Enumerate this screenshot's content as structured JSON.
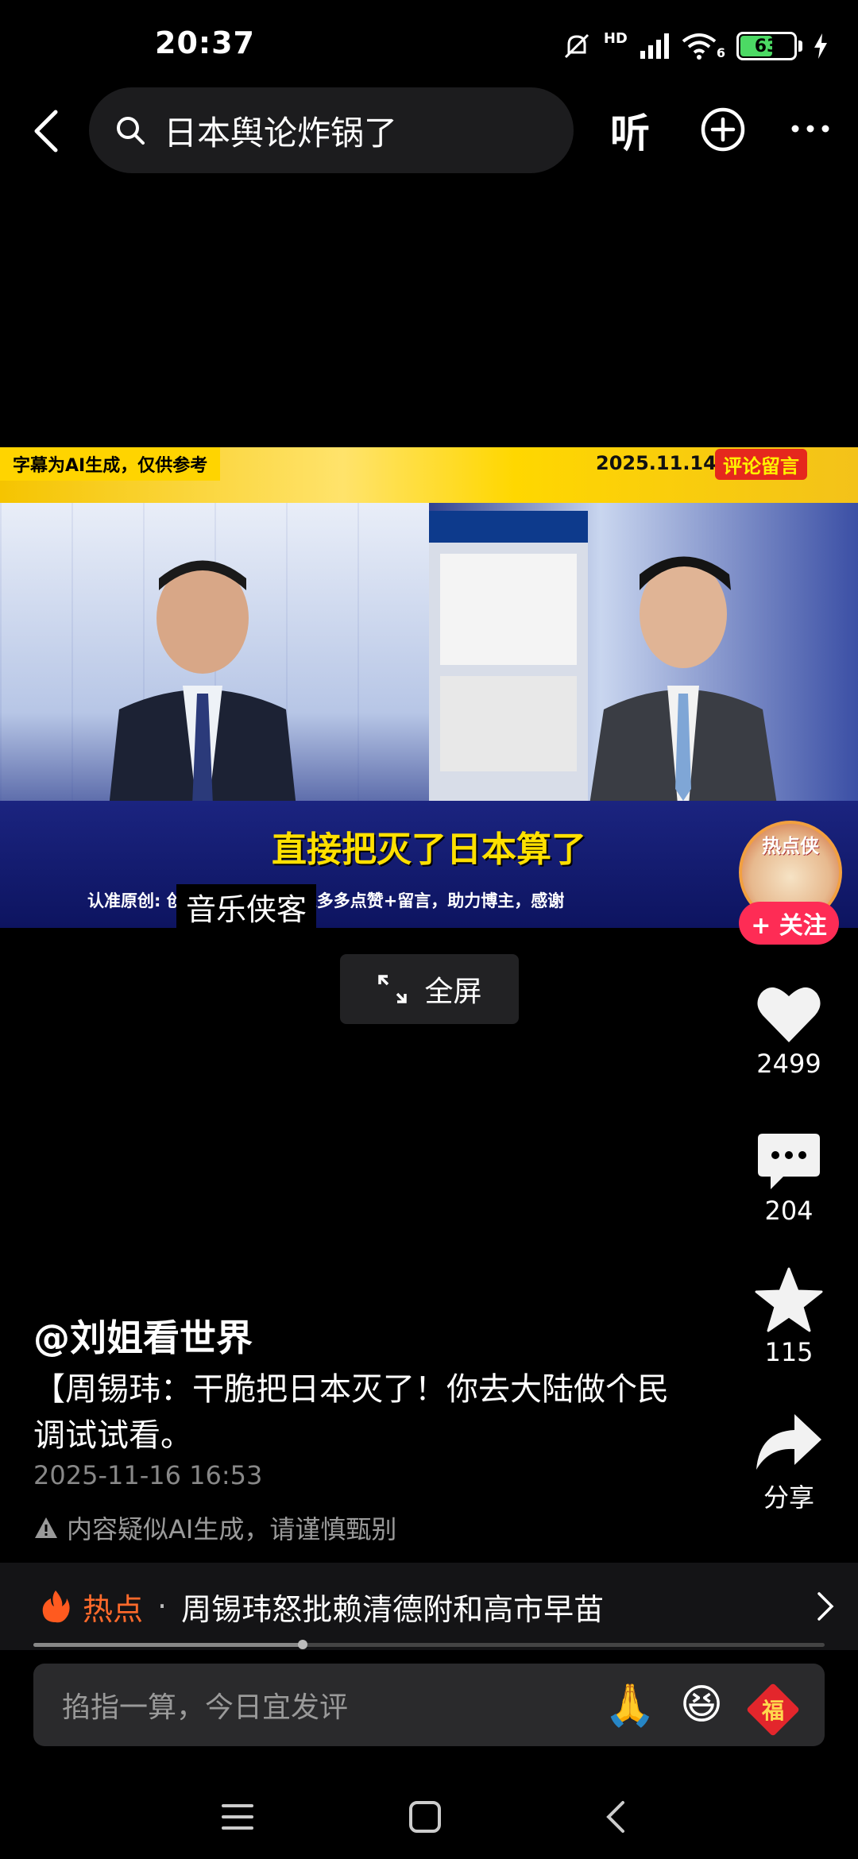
{
  "status_bar": {
    "time": "20:37",
    "network_label": "HD",
    "wifi_sub": "6",
    "battery": "63",
    "battery_level": 0.63
  },
  "header": {
    "search_query": "日本舆论炸锅了",
    "listen_label": "听",
    "icons": [
      "back-arrow-icon",
      "search-icon",
      "add-circle-icon",
      "more-icon"
    ]
  },
  "video": {
    "ai_notice": "字幕为AI生成，仅供参考",
    "date": "2025.11.14",
    "comment_tag": "评论留言",
    "headline": "直接把灭了日本算了",
    "credit": "认准原创:                              创作不易，希望大家多多点赞+留言，助力博主，感谢",
    "watermark": "音乐侠客",
    "hotspot_badge": "热点侠"
  },
  "actions": {
    "follow": "+ 关注",
    "fullscreen": "全屏",
    "likes": "2499",
    "comments": "204",
    "favorites": "115",
    "share": "分享"
  },
  "post": {
    "author": "@刘姐看世界",
    "caption": "【周锡玮：干脆把日本灭了！你去大陆做个民调试试看。",
    "timestamp": "2025-11-16 16:53",
    "ai_warning": "内容疑似AI生成，请谨慎甄别"
  },
  "hot_bar": {
    "label": "热点",
    "dot": "·",
    "title": "周锡玮怒批赖清德附和高市早苗"
  },
  "progress": {
    "fraction": 0.34
  },
  "comment_bar": {
    "placeholder": "掐指一算，今日宜发评",
    "emojis": [
      "🙏",
      "😆",
      "福"
    ]
  },
  "colors": {
    "accent": "#fe2c55",
    "hot": "#ff6a2b",
    "battery": "#4cd964"
  }
}
